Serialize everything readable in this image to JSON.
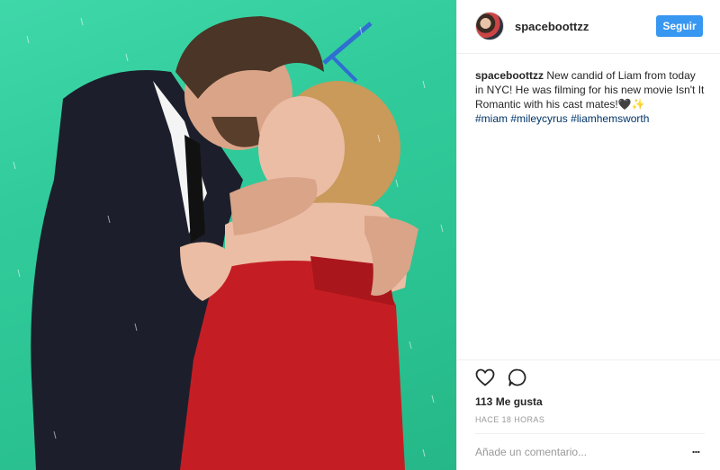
{
  "post": {
    "image_alt": "photo",
    "image_colors": {
      "background": "#31cb9b",
      "suit": "#1c1f2b",
      "dress": "#c41e24",
      "skin": "#e9b9a0",
      "hair_dark": "#4a3526",
      "hair_blonde": "#c99a5a"
    }
  },
  "header": {
    "username": "spaceboottzz",
    "follow_label": "Seguir",
    "avatar_icon": "profile-avatar"
  },
  "caption": {
    "username": "spaceboottzz",
    "text": "New candid of Liam from today in NYC! He was filming for his new movie Isn't It Romantic with his cast mates!🖤✨",
    "hashtags": [
      "#miam",
      "#mileycyrus",
      "#liamhemsworth"
    ]
  },
  "actions": {
    "like_icon": "heart-icon",
    "comment_icon": "comment-icon",
    "likes_text": "113 Me gusta",
    "time_text": "HACE 18 HORAS"
  },
  "comment": {
    "placeholder": "Añade un comentario...",
    "more_label": "..."
  },
  "colors": {
    "accent": "#3897f0",
    "hashtag": "#003569",
    "muted": "#999999",
    "border": "#efefef"
  }
}
